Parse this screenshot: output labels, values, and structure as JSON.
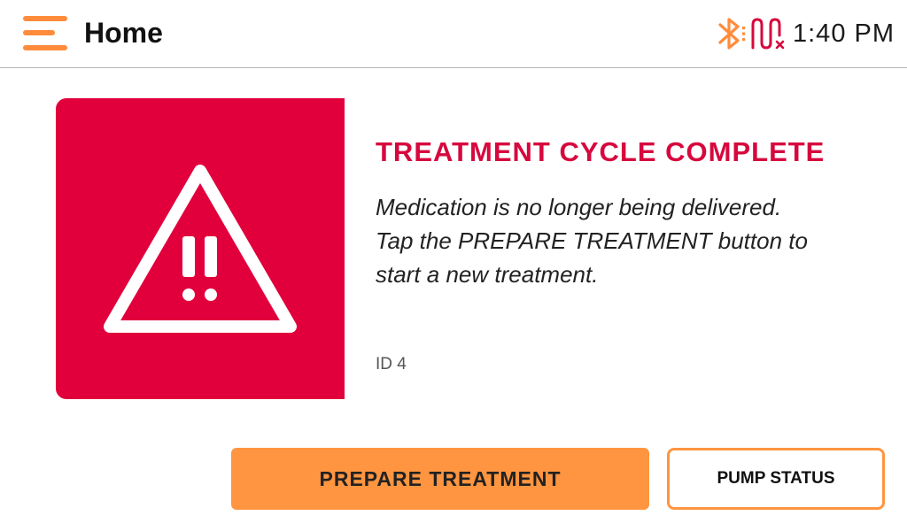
{
  "header": {
    "title": "Home",
    "time": "1:40 PM",
    "icons": {
      "menu": "hamburger-menu-icon",
      "bluetooth": "bluetooth-icon",
      "signal": "pump-signal-disconnected-icon"
    }
  },
  "alert": {
    "icon": "warning-triangle-icon",
    "title": "TREATMENT CYCLE COMPLETE",
    "message_lines": [
      "Medication is no longer being delivered.",
      "Tap the PREPARE TREATMENT button to",
      "start a new treatment."
    ],
    "id": "ID 4"
  },
  "actions": {
    "primary_label": "PREPARE TREATMENT",
    "secondary_label": "PUMP STATUS"
  },
  "colors": {
    "accent_orange": "#ff9540",
    "alert_red": "#e1003c",
    "title_red": "#d6083e",
    "signal_pink": "#d6083e"
  }
}
